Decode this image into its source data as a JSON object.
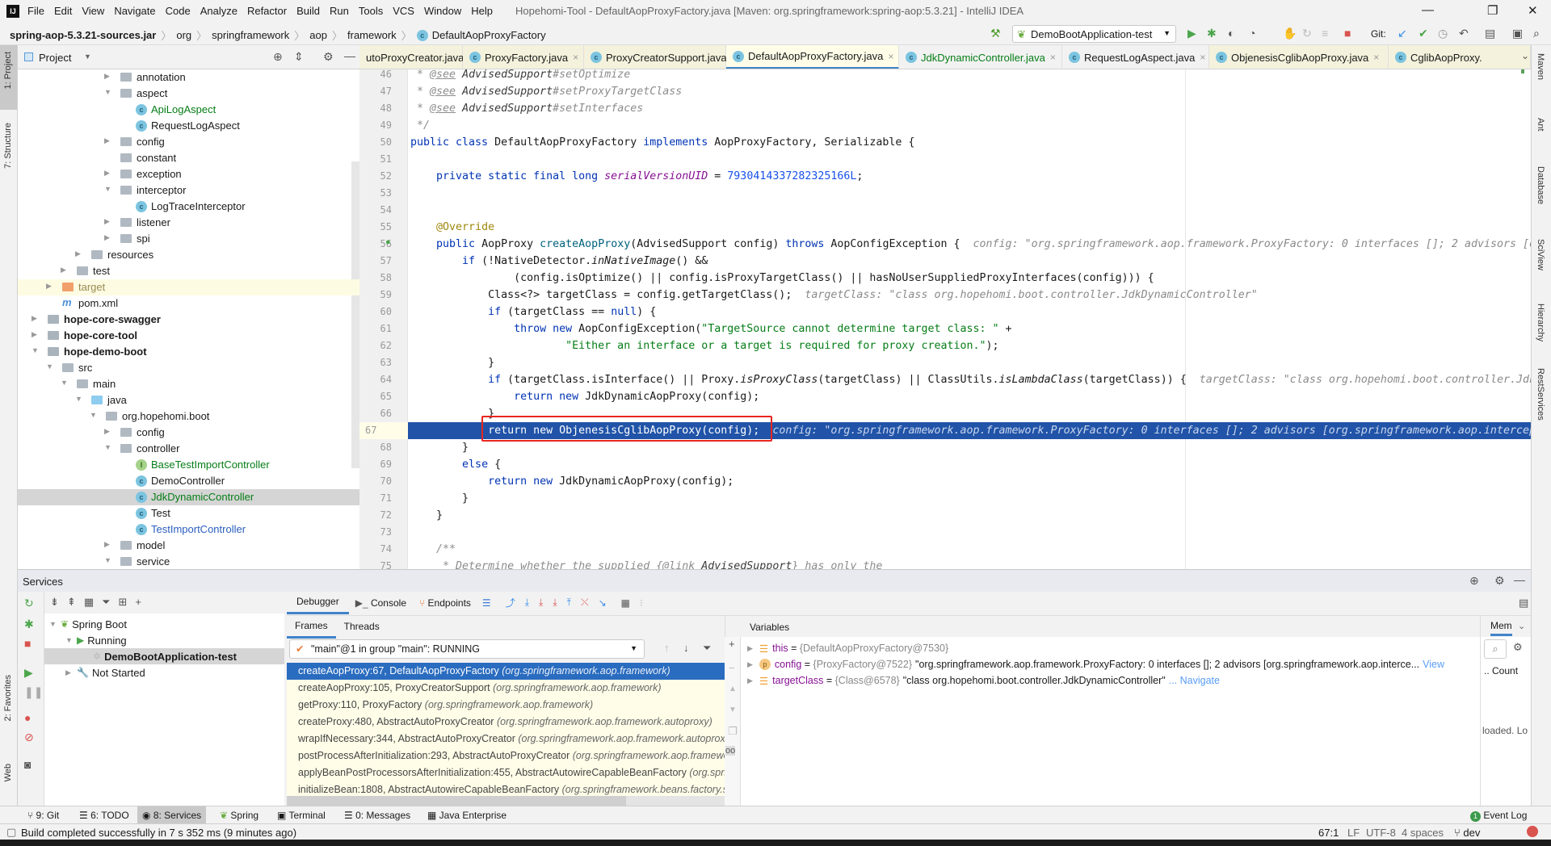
{
  "window": {
    "title": "Hopehomi-Tool - DefaultAopProxyFactory.java [Maven: org.springframework:spring-aop:5.3.21] - IntelliJ IDEA",
    "logo": "IJ"
  },
  "menu": [
    "File",
    "Edit",
    "View",
    "Navigate",
    "Code",
    "Analyze",
    "Refactor",
    "Build",
    "Run",
    "Tools",
    "VCS",
    "Window",
    "Help"
  ],
  "breadcrumb": [
    "spring-aop-5.3.21-sources.jar",
    "org",
    "springframework",
    "aop",
    "framework",
    "DefaultAopProxyFactory"
  ],
  "toolbar": {
    "run_config": "DemoBootApplication-test",
    "git_label": "Git:"
  },
  "project_panel": {
    "title": "Project",
    "items": [
      {
        "level": 5,
        "arrow": "right",
        "icon": "package",
        "label": "annotation"
      },
      {
        "level": 5,
        "arrow": "down",
        "icon": "package",
        "label": "aspect"
      },
      {
        "level": 6,
        "arrow": "",
        "icon": "class",
        "label": "ApiLogAspect",
        "color": "#067d17"
      },
      {
        "level": 6,
        "arrow": "",
        "icon": "class",
        "label": "RequestLogAspect"
      },
      {
        "level": 5,
        "arrow": "right",
        "icon": "package",
        "label": "config"
      },
      {
        "level": 5,
        "arrow": "",
        "icon": "package",
        "label": "constant"
      },
      {
        "level": 5,
        "arrow": "right",
        "icon": "package",
        "label": "exception"
      },
      {
        "level": 5,
        "arrow": "down",
        "icon": "package",
        "label": "interceptor"
      },
      {
        "level": 6,
        "arrow": "",
        "icon": "class",
        "label": "LogTraceInterceptor"
      },
      {
        "level": 5,
        "arrow": "right",
        "icon": "package",
        "label": "listener"
      },
      {
        "level": 5,
        "arrow": "right",
        "icon": "package",
        "label": "spi"
      },
      {
        "level": 3,
        "arrow": "right",
        "icon": "resources-folder",
        "label": "resources"
      },
      {
        "level": 2,
        "arrow": "right",
        "icon": "folder",
        "label": "test"
      },
      {
        "level": 1,
        "arrow": "right",
        "icon": "excluded-folder",
        "label": "target",
        "color": "#9a8b54",
        "highlight": "#fdfbe2"
      },
      {
        "level": 1,
        "arrow": "",
        "icon": "maven",
        "label": "pom.xml"
      },
      {
        "level": 0,
        "arrow": "right",
        "icon": "module",
        "label": "hope-core-swagger",
        "bold": true
      },
      {
        "level": 0,
        "arrow": "right",
        "icon": "module",
        "label": "hope-core-tool",
        "bold": true
      },
      {
        "level": 0,
        "arrow": "down",
        "icon": "module",
        "label": "hope-demo-boot",
        "bold": true
      },
      {
        "level": 1,
        "arrow": "down",
        "icon": "folder",
        "label": "src"
      },
      {
        "level": 2,
        "arrow": "down",
        "icon": "folder",
        "label": "main"
      },
      {
        "level": 3,
        "arrow": "down",
        "icon": "source-folder",
        "label": "java"
      },
      {
        "level": 4,
        "arrow": "down",
        "icon": "package",
        "label": "org.hopehomi.boot"
      },
      {
        "level": 5,
        "arrow": "right",
        "icon": "package",
        "label": "config"
      },
      {
        "level": 5,
        "arrow": "down",
        "icon": "package",
        "label": "controller"
      },
      {
        "level": 6,
        "arrow": "",
        "icon": "interface",
        "label": "BaseTestImportController",
        "color": "#067d17"
      },
      {
        "level": 6,
        "arrow": "",
        "icon": "class",
        "label": "DemoController"
      },
      {
        "level": 6,
        "arrow": "",
        "icon": "class",
        "label": "JdkDynamicController",
        "color": "#067d17",
        "highlight": "#d5d5d5"
      },
      {
        "level": 6,
        "arrow": "",
        "icon": "class",
        "label": "Test"
      },
      {
        "level": 6,
        "arrow": "",
        "icon": "class",
        "label": "TestImportController",
        "color": "#2a5ebf"
      },
      {
        "level": 5,
        "arrow": "right",
        "icon": "package",
        "label": "model"
      },
      {
        "level": 5,
        "arrow": "down",
        "icon": "package",
        "label": "service"
      }
    ]
  },
  "tabs": [
    {
      "label": "utoProxyCreator.java",
      "lib": true,
      "noicon": true
    },
    {
      "label": "ProxyFactory.java",
      "lib": true
    },
    {
      "label": "ProxyCreatorSupport.java",
      "lib": true
    },
    {
      "label": "DefaultAopProxyFactory.java",
      "active": true
    },
    {
      "label": "JdkDynamicController.java",
      "color": "#067d17"
    },
    {
      "label": "RequestLogAspect.java"
    },
    {
      "label": "ObjenesisCglibAopProxy.java",
      "lib": true
    },
    {
      "label": "CglibAopProxy.",
      "lib": true
    }
  ],
  "editor": {
    "highlight_line": 67,
    "lines": [
      {
        "n": 46,
        "s": [
          [
            "c",
            " * "
          ],
          [
            "u",
            "@see"
          ],
          [
            "ci",
            " AdvisedSupport"
          ],
          [
            "c",
            "#setOptimize"
          ]
        ]
      },
      {
        "n": 47,
        "s": [
          [
            "c",
            " * "
          ],
          [
            "u",
            "@see"
          ],
          [
            "ci",
            " AdvisedSupport"
          ],
          [
            "c",
            "#setProxyTargetClass"
          ]
        ]
      },
      {
        "n": 48,
        "s": [
          [
            "c",
            " * "
          ],
          [
            "u",
            "@see"
          ],
          [
            "ci",
            " AdvisedSupport"
          ],
          [
            "c",
            "#setInterfaces"
          ]
        ]
      },
      {
        "n": 49,
        "s": [
          [
            "c",
            " */"
          ]
        ]
      },
      {
        "n": 50,
        "s": [
          [
            "k",
            "public class "
          ],
          [
            "",
            "DefaultAopProxyFactory "
          ],
          [
            "k",
            "implements "
          ],
          [
            "",
            "AopProxyFactory, Serializable {"
          ]
        ]
      },
      {
        "n": 51,
        "s": []
      },
      {
        "n": 52,
        "s": [
          [
            "",
            "    "
          ],
          [
            "k",
            "private static final long "
          ],
          [
            "f",
            "serialVersionUID"
          ],
          [
            "",
            " = "
          ],
          [
            "n",
            "7930414337282325166L"
          ],
          [
            "",
            ";"
          ]
        ]
      },
      {
        "n": 53,
        "s": []
      },
      {
        "n": 54,
        "s": []
      },
      {
        "n": 55,
        "s": [
          [
            "",
            "    "
          ],
          [
            "a",
            "@Override"
          ]
        ]
      },
      {
        "n": 56,
        "s": [
          [
            "",
            "    "
          ],
          [
            "k",
            "public "
          ],
          [
            "",
            "AopProxy "
          ],
          [
            "fn",
            "createAopProxy"
          ],
          [
            "",
            "(AdvisedSupport config) "
          ],
          [
            "k",
            "throws "
          ],
          [
            "",
            "AopConfigException {  "
          ],
          [
            "h",
            "config: \"org.springframework.aop.framework.ProxyFactory: 0 interfaces []; 2 advisors [o"
          ]
        ]
      },
      {
        "n": 57,
        "s": [
          [
            "",
            "        "
          ],
          [
            "k",
            "if "
          ],
          [
            "",
            "(!NativeDetector."
          ],
          [
            "m",
            "inNativeImage"
          ],
          [
            "",
            "() &&"
          ]
        ]
      },
      {
        "n": 58,
        "s": [
          [
            "",
            "                (config.isOptimize() || config.isProxyTargetClass() || hasNoUserSuppliedProxyInterfaces(config))) {"
          ]
        ]
      },
      {
        "n": 59,
        "s": [
          [
            "",
            "            Class<?> targetClass = config.getTargetClass();  "
          ],
          [
            "h",
            "targetClass: \"class org.hopehomi.boot.controller.JdkDynamicController\""
          ]
        ]
      },
      {
        "n": 60,
        "s": [
          [
            "",
            "            "
          ],
          [
            "k",
            "if "
          ],
          [
            "",
            "(targetClass == "
          ],
          [
            "k",
            "null"
          ],
          [
            "",
            ") {"
          ]
        ]
      },
      {
        "n": 61,
        "s": [
          [
            "",
            "                "
          ],
          [
            "k",
            "throw new "
          ],
          [
            "",
            "AopConfigException("
          ],
          [
            "s",
            "\"TargetSource cannot determine target class: \""
          ],
          [
            "",
            " +"
          ]
        ]
      },
      {
        "n": 62,
        "s": [
          [
            "",
            "                        "
          ],
          [
            "s",
            "\"Either an interface or a target is required for proxy creation.\""
          ],
          [
            "",
            ");"
          ]
        ]
      },
      {
        "n": 63,
        "s": [
          [
            "",
            "            }"
          ]
        ]
      },
      {
        "n": 64,
        "s": [
          [
            "",
            "            "
          ],
          [
            "k",
            "if "
          ],
          [
            "",
            "(targetClass.isInterface() || Proxy."
          ],
          [
            "m",
            "isProxyClass"
          ],
          [
            "",
            "(targetClass) || ClassUtils."
          ],
          [
            "m",
            "isLambdaClass"
          ],
          [
            "",
            "(targetClass)) {  "
          ],
          [
            "h",
            "targetClass: \"class org.hopehomi.boot.controller.Jdk"
          ]
        ]
      },
      {
        "n": 65,
        "s": [
          [
            "",
            "                "
          ],
          [
            "k",
            "return new "
          ],
          [
            "",
            "JdkDynamicAopProxy(config);"
          ]
        ]
      },
      {
        "n": 66,
        "s": [
          [
            "",
            "            }"
          ]
        ]
      },
      {
        "n": 67,
        "s": [
          [
            "",
            "            "
          ],
          [
            "k",
            "return new "
          ],
          [
            "",
            "ObjenesisCglibAopProxy(config);  "
          ],
          [
            "h",
            "config: \"org.springframework.aop.framework.ProxyFactory: 0 interfaces []; 2 advisors [org.springframework.aop.intercep"
          ]
        ]
      },
      {
        "n": 68,
        "s": [
          [
            "",
            "        }"
          ]
        ]
      },
      {
        "n": 69,
        "s": [
          [
            "",
            "        "
          ],
          [
            "k",
            "else "
          ],
          [
            "",
            "{"
          ]
        ]
      },
      {
        "n": 70,
        "s": [
          [
            "",
            "            "
          ],
          [
            "k",
            "return new "
          ],
          [
            "",
            "JdkDynamicAopProxy(config);"
          ]
        ]
      },
      {
        "n": 71,
        "s": [
          [
            "",
            "        }"
          ]
        ]
      },
      {
        "n": 72,
        "s": [
          [
            "",
            "    }"
          ]
        ]
      },
      {
        "n": 73,
        "s": []
      },
      {
        "n": 74,
        "s": [
          [
            "c",
            "    /**"
          ]
        ]
      },
      {
        "n": 75,
        "s": [
          [
            "c",
            "     * Determine whether the supplied {"
          ],
          [
            "u",
            "@link"
          ],
          [
            "ci",
            " AdvisedSupport"
          ],
          [
            "c",
            "} has only the"
          ]
        ]
      }
    ]
  },
  "services": {
    "title": "Services",
    "tree": [
      {
        "label": "Spring Boot",
        "indent": 0,
        "arrow": "▼"
      },
      {
        "label": "Running",
        "indent": 1,
        "arrow": "▼"
      },
      {
        "label": "DemoBootApplication-test",
        "indent": 2,
        "arrow": "",
        "bold": true,
        "selected": true
      },
      {
        "label": "Not Started",
        "indent": 1,
        "arrow": "▶"
      }
    ],
    "debug_tabs": [
      "Debugger",
      "Console",
      "Endpoints"
    ],
    "sub_tabs": [
      "Frames",
      "Threads"
    ],
    "thread": "\"main\"@1 in group \"main\": RUNNING",
    "frames": [
      {
        "method": "createAopProxy:67, DefaultAopProxyFactory",
        "pkg": "(org.springframework.aop.framework)",
        "selected": true
      },
      {
        "method": "createAopProxy:105, ProxyCreatorSupport",
        "pkg": "(org.springframework.aop.framework)"
      },
      {
        "method": "getProxy:110, ProxyFactory",
        "pkg": "(org.springframework.aop.framework)"
      },
      {
        "method": "createProxy:480, AbstractAutoProxyCreator",
        "pkg": "(org.springframework.aop.framework.autoproxy)"
      },
      {
        "method": "wrapIfNecessary:344, AbstractAutoProxyCreator",
        "pkg": "(org.springframework.aop.framework.autoproxy)"
      },
      {
        "method": "postProcessAfterInitialization:293, AbstractAutoProxyCreator",
        "pkg": "(org.springframework.aop.framework.autoproxy)"
      },
      {
        "method": "applyBeanPostProcessorsAfterInitialization:455, AbstractAutowireCapableBeanFactory",
        "pkg": "(org.springframework.beans.factory.support)"
      },
      {
        "method": "initializeBean:1808, AbstractAutowireCapableBeanFactory",
        "pkg": "(org.springframework.beans.factory.support)"
      }
    ],
    "variables_title": "Variables",
    "variables": [
      {
        "name": "this",
        "ref": "{DefaultAopProxyFactory@7530}",
        "value": "",
        "link": "",
        "icon": "field"
      },
      {
        "name": "config",
        "ref": "{ProxyFactory@7522}",
        "value": "\"org.springframework.aop.framework.ProxyFactory: 0 interfaces []; 2 advisors [org.springframework.aop.interce...",
        "link": "View",
        "icon": "param"
      },
      {
        "name": "targetClass",
        "ref": "{Class@6578}",
        "value": "\"class org.hopehomi.boot.controller.JdkDynamicController\"",
        "link": "... Navigate",
        "icon": "field"
      }
    ],
    "memory": {
      "tab": "Mem",
      "count": "Count",
      "loaded": "loaded. Lo"
    }
  },
  "tool_tabs": [
    "9: Git",
    "6: TODO",
    "8: Services",
    "Spring",
    "Terminal",
    "0: Messages",
    "Java Enterprise"
  ],
  "event_log": {
    "count": "1",
    "label": "Event Log"
  },
  "status": {
    "message": "Build completed successfully in 7 s 352 ms (9 minutes ago)",
    "position": "67:1",
    "line_sep": "LF",
    "encoding": "UTF-8",
    "indent": "4 spaces",
    "branch": "dev"
  },
  "left_strip": [
    "1: Project",
    "7: Structure",
    "2: Favorites",
    "Web"
  ],
  "right_strip": [
    "Maven",
    "Ant",
    "Database",
    "SciView",
    "Hierarchy",
    "RestServices"
  ],
  "colors": {
    "highlight_line": "#2154a8",
    "selected_frame": "#2a6cbf",
    "breakpoint_box": "#e8261f"
  }
}
